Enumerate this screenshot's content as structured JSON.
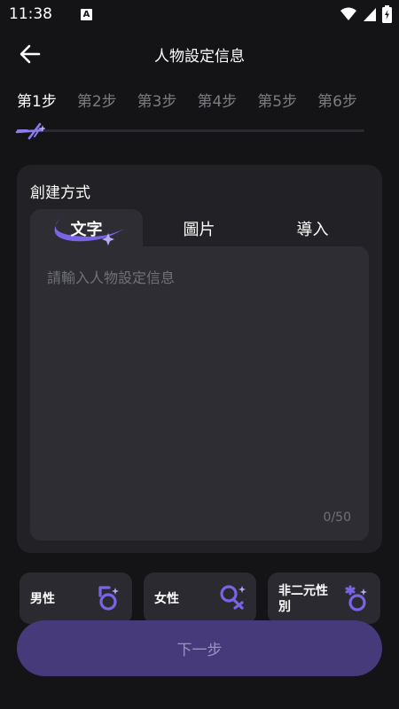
{
  "status_bar": {
    "time": "11:38",
    "notification_badge": "A"
  },
  "header": {
    "title": "人物設定信息"
  },
  "steps": [
    {
      "label": "第1步",
      "active": true
    },
    {
      "label": "第2步",
      "active": false
    },
    {
      "label": "第3步",
      "active": false
    },
    {
      "label": "第4步",
      "active": false
    },
    {
      "label": "第5步",
      "active": false
    },
    {
      "label": "第6步",
      "active": false
    }
  ],
  "step_progress": {
    "current": 1,
    "total": 6
  },
  "creation": {
    "title": "創建方式",
    "tabs": [
      {
        "label": "文字",
        "active": true
      },
      {
        "label": "圖片",
        "active": false
      },
      {
        "label": "導入",
        "active": false
      }
    ],
    "input": {
      "value": "",
      "placeholder": "請輸入人物設定信息"
    },
    "char_count": "0/50"
  },
  "gender_options": [
    {
      "label": "男性",
      "icon": "male-symbol-icon"
    },
    {
      "label": "女性",
      "icon": "female-symbol-icon"
    },
    {
      "label": "非二元性別",
      "icon": "nonbinary-symbol-icon"
    }
  ],
  "next_button": {
    "label": "下一步"
  },
  "colors": {
    "background": "#141417",
    "card": "#212126",
    "accent": "#8b7ce8",
    "icon_accent": "#7a63e6",
    "button": "#463a7a"
  }
}
